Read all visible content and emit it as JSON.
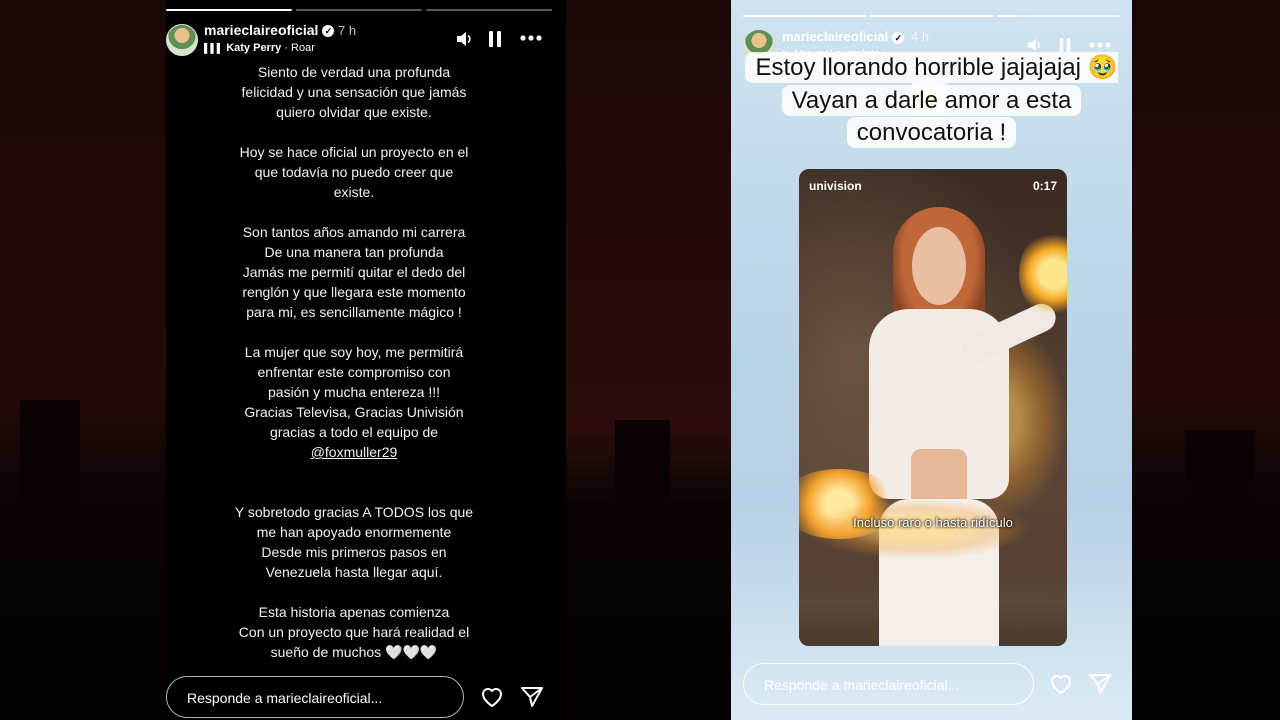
{
  "left_story": {
    "progress": [
      1.0,
      0.0,
      0.0
    ],
    "username": "marieclaireoficial",
    "time": "7 h",
    "music_artist": "Katy Perry",
    "music_sep": "·",
    "music_song": "Roar",
    "paragraphs": [
      [
        "Siento de verdad una profunda",
        "felicidad y una sensación que jamás",
        "quiero olvidar que existe."
      ],
      [
        "Hoy se hace oficial un proyecto en el",
        "que todavía no puedo creer que",
        "existe."
      ],
      [
        "Son tantos años amando mi carrera",
        "De una manera tan profunda",
        "Jamás me permití quitar el dedo del",
        "renglón y que llegara este momento",
        "para mi, es sencillamente mágico !"
      ],
      [
        "La mujer que soy hoy, me permitirá",
        "enfrentar este compromiso con",
        "pasión y mucha entereza !!!",
        "Gracias Televisa, Gracias Univisión",
        "gracias a todo el equipo de"
      ],
      [
        "Y sobretodo gracias A TODOS los que",
        "me han apoyado enormemente",
        "Desde mis primeros pasos en",
        "Venezuela hasta llegar aquí."
      ],
      [
        "Esta historia apenas comienza",
        "Con un proyecto que hará realidad el"
      ]
    ],
    "mention": "@foxmuller29",
    "last_line": "sueño de muchos 🤍🤍🤍",
    "reply_placeholder": "Responde a marieclaireoficial..."
  },
  "right_story": {
    "progress": [
      1.0,
      1.0,
      0.15
    ],
    "username": "marieclaireoficial",
    "time": "4 h",
    "reel_link": "Ver reel completo",
    "caption_lines": [
      "Estoy llorando horrible jajajajaj 🥹✨",
      "Vayan a darle amor a esta",
      "convocatoria !"
    ],
    "video": {
      "brand": "univision",
      "duration": "0:17",
      "subtitle": "Incluso raro o hasta ridículo"
    },
    "reply_placeholder": "Responde a marieclaireoficial..."
  },
  "icons": {
    "verified": "verified-badge-icon",
    "music": "music-bars-icon",
    "sound": "speaker-icon",
    "pause": "pause-icon",
    "more": "more-dots-icon",
    "like": "heart-icon",
    "share": "send-icon"
  }
}
